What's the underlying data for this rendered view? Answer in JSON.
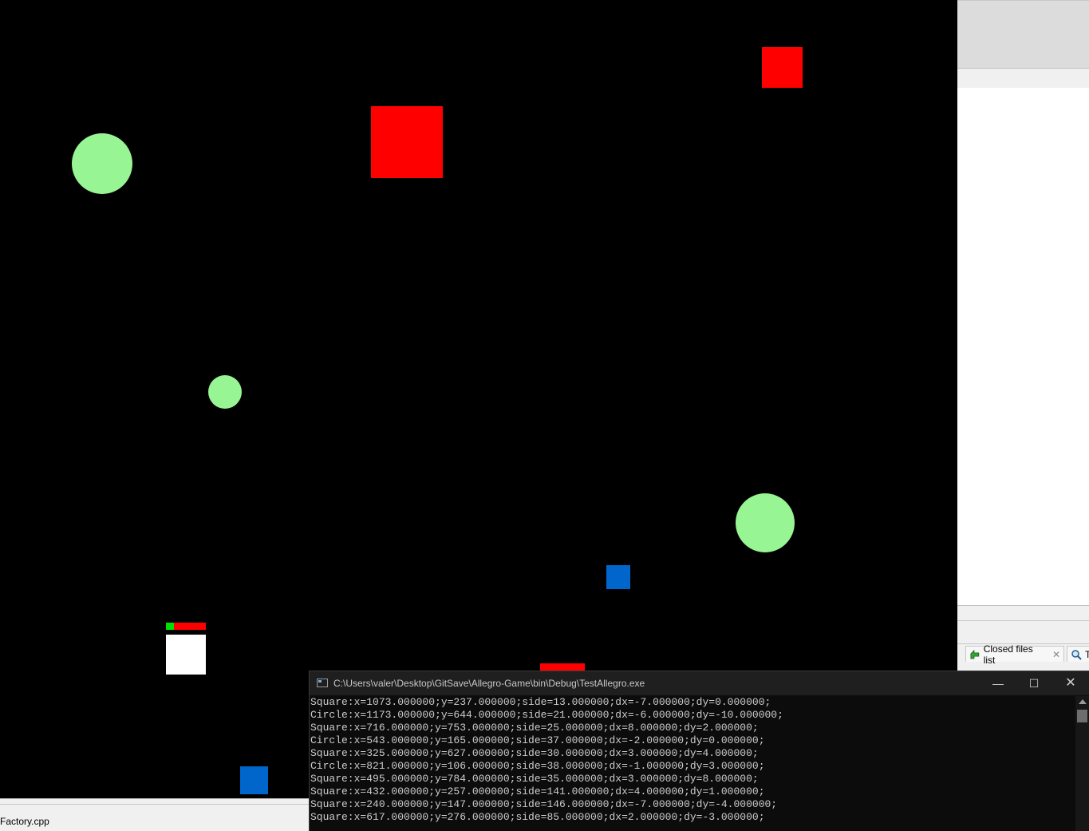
{
  "game": {
    "background": "#000000",
    "shapes": [
      {
        "kind": "square",
        "color": "#ff0000"
      },
      {
        "kind": "square",
        "color": "#ff0000"
      },
      {
        "kind": "circle",
        "color": "#98f593"
      },
      {
        "kind": "circle",
        "color": "#98f593"
      },
      {
        "kind": "circle",
        "color": "#98f593"
      },
      {
        "kind": "square",
        "color": "#0066cc"
      },
      {
        "kind": "square",
        "color": "#0066cc"
      },
      {
        "kind": "square",
        "color": "#ff0000"
      }
    ],
    "player": {
      "color": "#ffffff",
      "health_fraction": 0.2,
      "health_color": "#00e000",
      "damage_color": "#ff0000"
    }
  },
  "ide": {
    "tabs": [
      {
        "label": "Closed files list",
        "icon": "closed-files-icon",
        "close": "✕"
      },
      {
        "label": "T",
        "icon": "search-icon"
      }
    ],
    "status_file": "Factory.cpp"
  },
  "console": {
    "title": "C:\\Users\\valer\\Desktop\\GitSave\\Allegro-Game\\bin\\Debug\\TestAllegro.exe",
    "buttons": {
      "minimize": "—",
      "maximize": "☐",
      "close": "✕"
    },
    "lines": [
      "Square:x=1073.000000;y=237.000000;side=13.000000;dx=-7.000000;dy=0.000000;",
      "Circle:x=1173.000000;y=644.000000;side=21.000000;dx=-6.000000;dy=-10.000000;",
      "Square:x=716.000000;y=753.000000;side=25.000000;dx=8.000000;dy=2.000000;",
      "Circle:x=543.000000;y=165.000000;side=37.000000;dx=-2.000000;dy=0.000000;",
      "Square:x=325.000000;y=627.000000;side=30.000000;dx=3.000000;dy=4.000000;",
      "Circle:x=821.000000;y=106.000000;side=38.000000;dx=-1.000000;dy=3.000000;",
      "Square:x=495.000000;y=784.000000;side=35.000000;dx=3.000000;dy=8.000000;",
      "Square:x=432.000000;y=257.000000;side=141.000000;dx=4.000000;dy=1.000000;",
      "Square:x=240.000000;y=147.000000;side=146.000000;dx=-7.000000;dy=-4.000000;",
      "Square:x=617.000000;y=276.000000;side=85.000000;dx=2.000000;dy=-3.000000;"
    ]
  }
}
